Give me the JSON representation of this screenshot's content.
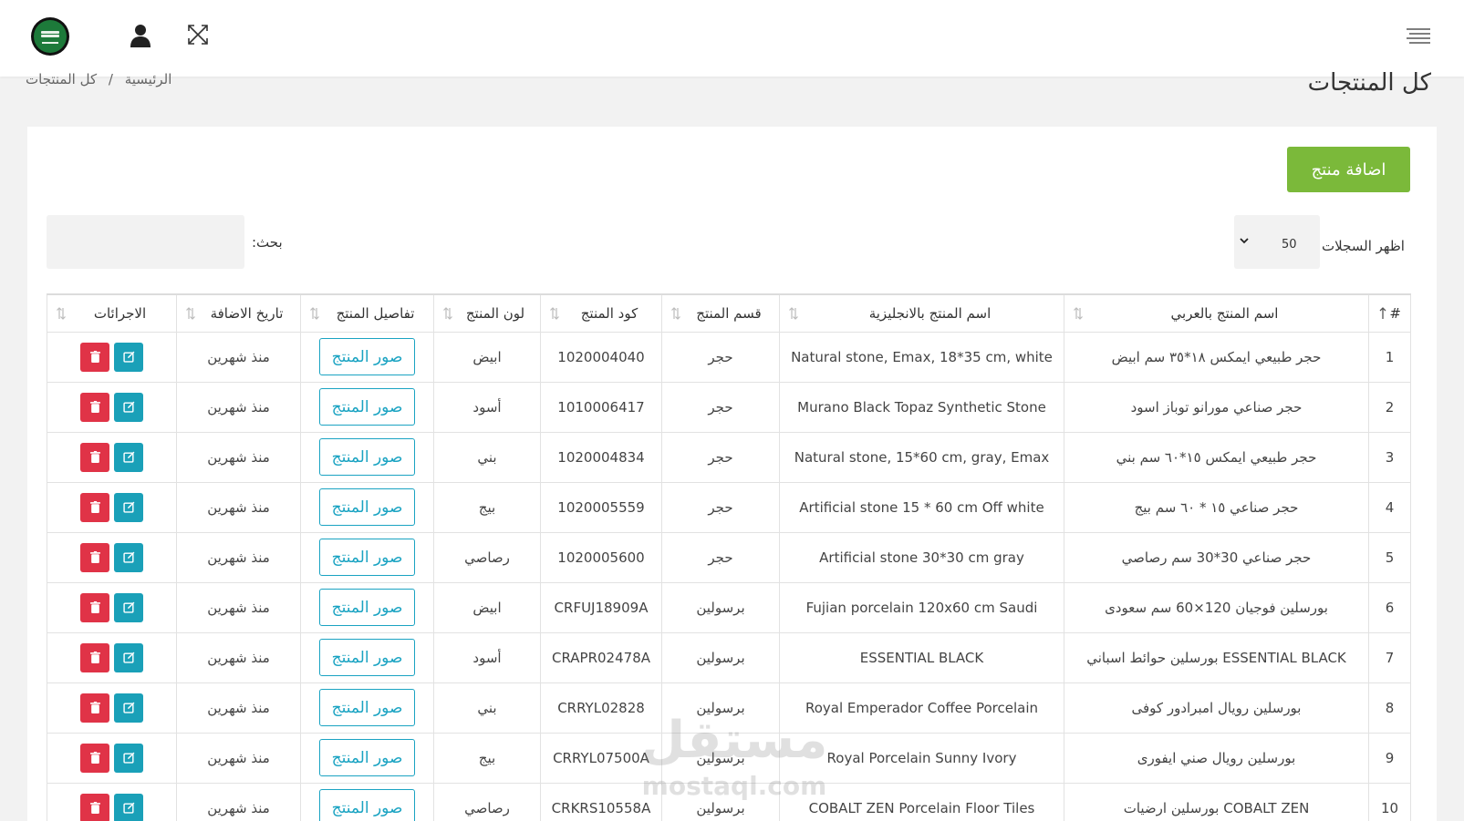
{
  "header": {
    "flag_icon": "saudi-flag-icon",
    "user_icon": "user-icon",
    "expand_icon": "fullscreen-icon",
    "menu_icon": "hamburger-menu-icon"
  },
  "breadcrumb": {
    "home": "الرئيسية",
    "separator": "/",
    "current": "كل المنتجات"
  },
  "page_title": "كل المنتجات",
  "toolbar": {
    "add_label": "اضافة منتج",
    "length_label": "اظهر السجلات",
    "length_value": "50",
    "search_label": "بحث:",
    "search_value": ""
  },
  "table": {
    "headers": {
      "num": "#",
      "name_ar": "اسم المنتج بالعربي",
      "name_en": "اسم المنتج بالانجليزية",
      "category": "قسم المنتج",
      "code": "كود المنتج",
      "color": "لون المنتج",
      "details": "تفاصيل المنتج",
      "date": "تاريخ الاضافة",
      "actions": "الاجرائات"
    },
    "photos_label": "صور المنتج",
    "rows": [
      {
        "num": "1",
        "name_ar": "حجر طبيعي ايمكس ١٨*٣٥ سم ابيض",
        "name_en": "Natural stone, Emax, 18*35 cm, white",
        "category": "حجر",
        "code": "1020004040",
        "color": "ابيض",
        "date": "منذ شهرين"
      },
      {
        "num": "2",
        "name_ar": "حجر صناعي مورانو توباز اسود",
        "name_en": "Murano Black Topaz Synthetic Stone",
        "category": "حجر",
        "code": "1010006417",
        "color": "أسود",
        "date": "منذ شهرين"
      },
      {
        "num": "3",
        "name_ar": "حجر طبيعي ايمكس ١٥*٦٠ سم بني",
        "name_en": "Natural stone, 15*60 cm, gray, Emax",
        "category": "حجر",
        "code": "1020004834",
        "color": "بني",
        "date": "منذ شهرين"
      },
      {
        "num": "4",
        "name_ar": "حجر صناعي ١٥ * ٦٠ سم بيج",
        "name_en": "Artificial stone 15 * 60 cm Off white",
        "category": "حجر",
        "code": "1020005559",
        "color": "بيج",
        "date": "منذ شهرين"
      },
      {
        "num": "5",
        "name_ar": "حجر صناعي 30*30 سم رصاصي",
        "name_en": "Artificial stone 30*30 cm gray",
        "category": "حجر",
        "code": "1020005600",
        "color": "رصاصي",
        "date": "منذ شهرين"
      },
      {
        "num": "6",
        "name_ar": "بورسلين فوجيان 120×60 سم سعودى",
        "name_en": "Fujian porcelain 120x60 cm Saudi",
        "category": "برسولين",
        "code": "CRFUJ18909A",
        "color": "ابيض",
        "date": "منذ شهرين"
      },
      {
        "num": "7",
        "name_ar": "ESSENTIAL BLACK بورسلين حوائط اسباني",
        "name_en": "ESSENTIAL BLACK",
        "category": "برسولين",
        "code": "CRAPR02478A",
        "color": "أسود",
        "date": "منذ شهرين"
      },
      {
        "num": "8",
        "name_ar": "بورسلين رويال امبرادور كوفى",
        "name_en": "Royal Emperador Coffee Porcelain",
        "category": "برسولين",
        "code": "CRRYL02828",
        "color": "بني",
        "date": "منذ شهرين"
      },
      {
        "num": "9",
        "name_ar": "بورسلين رويال صني ايفورى",
        "name_en": "Royal Porcelain Sunny Ivory",
        "category": "برسولين",
        "code": "CRRYL07500A",
        "color": "بيج",
        "date": "منذ شهرين"
      },
      {
        "num": "10",
        "name_ar": "COBALT ZEN بورسلين ارضيات",
        "name_en": "COBALT ZEN Porcelain Floor Tiles",
        "category": "برسولين",
        "code": "CRKRS10558A",
        "color": "رصاصي",
        "date": "منذ شهرين"
      }
    ]
  },
  "watermark": {
    "ar": "مستقل",
    "en": "mostaql.com"
  },
  "colors": {
    "accent_green": "#7bb93a",
    "accent_cyan": "#1aa3c2",
    "danger_red": "#e03347"
  }
}
